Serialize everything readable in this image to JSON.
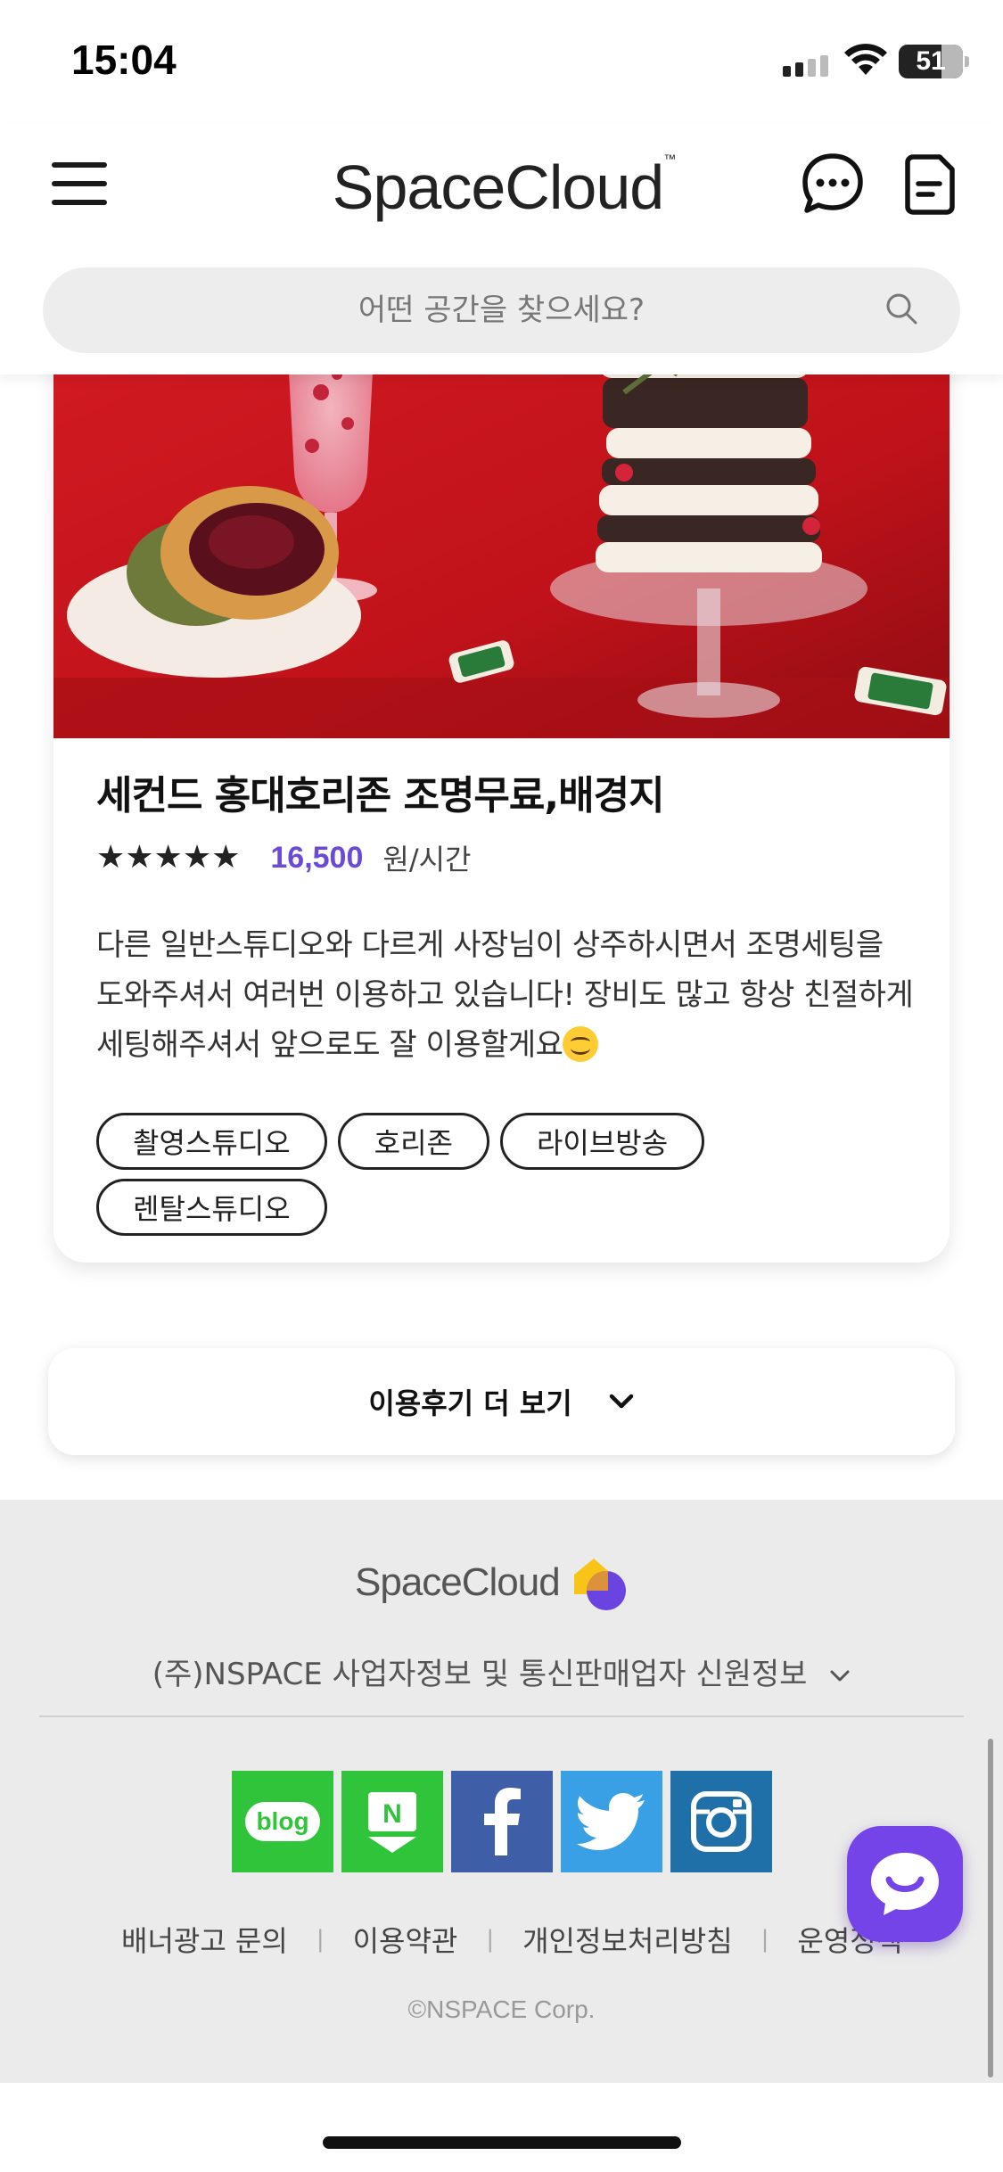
{
  "status_bar": {
    "time": "15:04",
    "battery": "51"
  },
  "header": {
    "logo": "SpaceCloud",
    "logo_tm": "™",
    "search_placeholder": "어떤 공간을 찾으세요?",
    "icons": [
      "menu-icon",
      "chat-bubble-icon",
      "document-icon",
      "search-icon"
    ]
  },
  "review": {
    "title": "세컨드 홍대호리존 조명무료,배경지",
    "stars": "★★★★★",
    "rating": 5,
    "price": "16,500",
    "price_unit": "원/시간",
    "text": "다른 일반스튜디오와 다르게 사장님이 상주하시면서 조명세팅을 도와주셔서 여러번 이용하고 있습니다! 장비도 많고 항상 친절하게 세팅해주셔서 앞으로도 잘 이용할게요",
    "tags": [
      "촬영스튜디오",
      "호리존",
      "라이브방송",
      "렌탈스튜디오"
    ]
  },
  "more_button": {
    "label": "이용후기 더 보기"
  },
  "footer": {
    "logo": "SpaceCloud",
    "company_info": "(주)NSPACE 사업자정보 및 통신판매업자 신원정보",
    "social": [
      "blog",
      "naver-post",
      "facebook",
      "twitter",
      "instagram"
    ],
    "blog_label": "blog",
    "naver_label": "N",
    "links": [
      "배너광고 문의",
      "이용약관",
      "개인정보처리방침",
      "운영정책"
    ],
    "copyright": "©NSPACE Corp."
  },
  "colors": {
    "accent": "#6a4ad6",
    "fab": "#7444e8",
    "footer_bg": "#ebebeb",
    "social_green": "#2fc43a",
    "facebook": "#3e5fa8",
    "twitter": "#3aa0e6",
    "instagram": "#1f6fa8"
  }
}
